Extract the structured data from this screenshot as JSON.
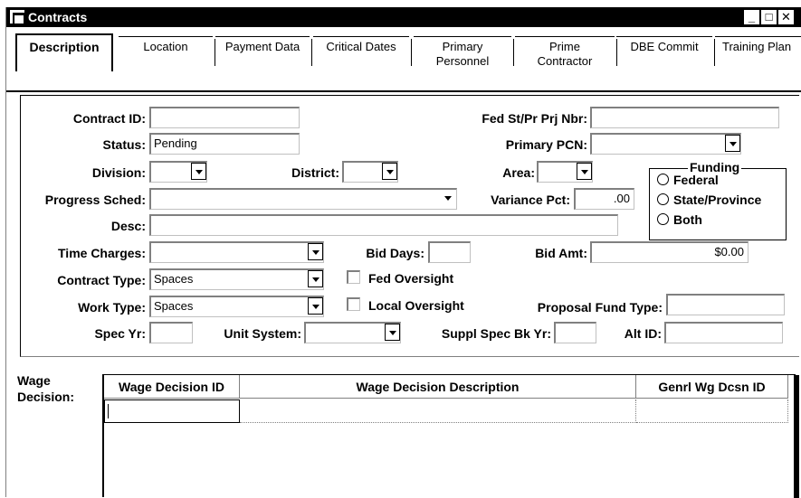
{
  "window": {
    "title": "Contracts"
  },
  "title_buttons": {
    "minimize": "_",
    "maximize": "□",
    "close": "✕"
  },
  "tabs": [
    {
      "label": "Description"
    },
    {
      "label": "Location"
    },
    {
      "label": "Payment Data"
    },
    {
      "label": "Critical Dates"
    },
    {
      "label": "Primary Personnel"
    },
    {
      "label": "Prime Contractor"
    },
    {
      "label": "DBE Commit"
    },
    {
      "label": "Training Plan"
    }
  ],
  "form": {
    "contract_id": {
      "label": "Contract ID:",
      "value": ""
    },
    "status": {
      "label": "Status:",
      "value": "Pending"
    },
    "fed_prj": {
      "label": "Fed St/Pr Prj Nbr:",
      "value": ""
    },
    "primary_pcn": {
      "label": "Primary PCN:",
      "value": ""
    },
    "division": {
      "label": "Division:",
      "value": ""
    },
    "district": {
      "label": "District:",
      "value": ""
    },
    "area": {
      "label": "Area:",
      "value": ""
    },
    "progress_sched": {
      "label": "Progress Sched:",
      "value": ""
    },
    "variance_pct": {
      "label": "Variance Pct:",
      "value": ".00"
    },
    "desc": {
      "label": "Desc:",
      "value": ""
    },
    "time_charges": {
      "label": "Time Charges:",
      "value": ""
    },
    "bid_days": {
      "label": "Bid Days:",
      "value": ""
    },
    "bid_amt": {
      "label": "Bid Amt:",
      "value": "$0.00"
    },
    "contract_type": {
      "label": "Contract Type:",
      "value": "Spaces"
    },
    "fed_oversight": {
      "label": "Fed Oversight",
      "checked": false
    },
    "work_type": {
      "label": "Work Type:",
      "value": "Spaces"
    },
    "local_oversight": {
      "label": "Local Oversight",
      "checked": false
    },
    "proposal_fund_type": {
      "label": "Proposal Fund Type:",
      "value": ""
    },
    "spec_yr": {
      "label": "Spec Yr:",
      "value": ""
    },
    "unit_system": {
      "label": "Unit System:",
      "value": ""
    },
    "suppl_spec_bk_yr": {
      "label": "Suppl Spec Bk Yr:",
      "value": ""
    },
    "alt_id": {
      "label": "Alt ID:",
      "value": ""
    }
  },
  "funding": {
    "legend": "Funding",
    "options": [
      "Federal",
      "State/Province",
      "Both"
    ]
  },
  "wage": {
    "label_line1": "Wage",
    "label_line2": "Decision:",
    "columns": [
      "Wage Decision ID",
      "Wage Decision Description",
      "Genrl Wg Dcsn ID"
    ]
  }
}
